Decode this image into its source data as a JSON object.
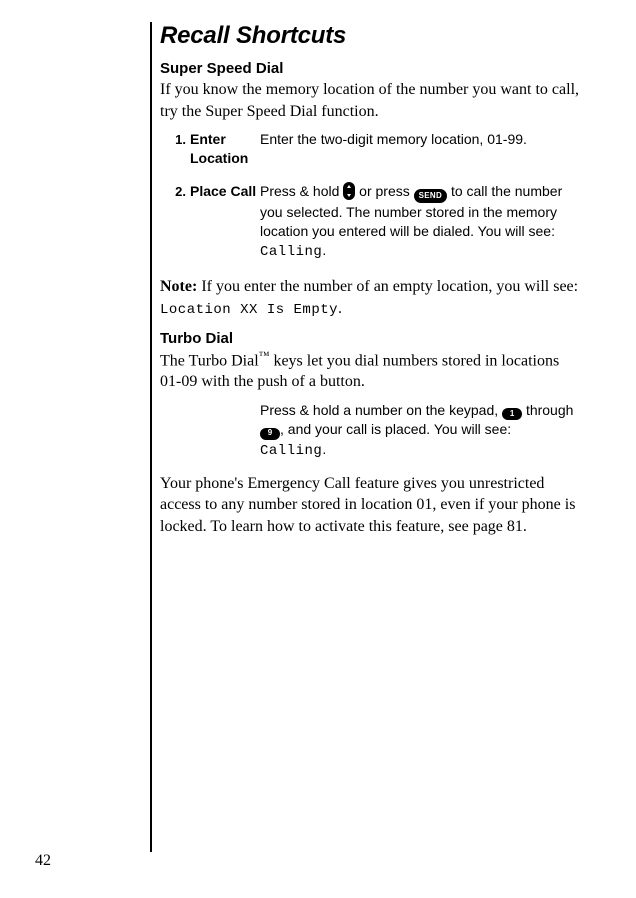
{
  "title": "Recall Shortcuts",
  "section1": {
    "heading": "Super Speed Dial",
    "intro": "If you know the memory location of the number you want to call, try the Super Speed Dial function."
  },
  "steps": [
    {
      "num": "1.",
      "name": "Enter Location",
      "desc": "Enter the two-digit memory location, 01-99."
    },
    {
      "num": "2.",
      "name": "Place Call",
      "desc_a": "Press & hold ",
      "desc_b": " or press ",
      "desc_c": " to call the number you selected. The number stored in the memory location you entered will be dialed. You will see: ",
      "calling": "Calling",
      "period": "."
    }
  ],
  "keys": {
    "send": "SEND",
    "one": "1",
    "nine": "9"
  },
  "note": {
    "lead": "Note:",
    "a": " If you enter the number of an empty location, you will see: ",
    "code": "Location XX Is Empty",
    "period": "."
  },
  "section2": {
    "heading": "Turbo Dial",
    "intro_a": "The Turbo Dial",
    "tm": "™",
    "intro_b": " keys let you dial numbers stored in locations 01-09 with the push of a button."
  },
  "turbo": {
    "a": "Press & hold a number on the keypad, ",
    "b": " through ",
    "c": ", and your call is placed. You will see: ",
    "calling": "Calling",
    "period": "."
  },
  "emergency": "Your phone's Emergency Call feature gives you unrestricted access to any number stored in location 01, even if your phone is locked. To learn how to activate this feature, see page 81.",
  "page_number": "42"
}
